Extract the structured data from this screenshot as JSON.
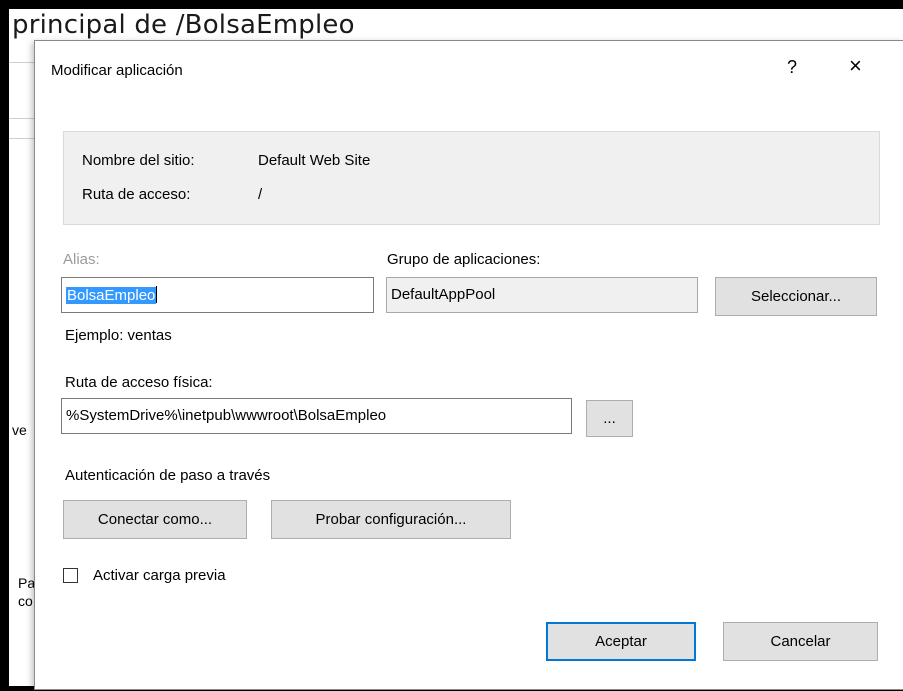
{
  "background": {
    "title": "principal de /BolsaEmpleo",
    "fragments": [
      "ve",
      "Pa",
      "co"
    ]
  },
  "dialog": {
    "title": "Modificar aplicación",
    "help_label": "?",
    "close_label": "×",
    "site_name_label": "Nombre del sitio:",
    "site_name_value": "Default Web Site",
    "path_label": "Ruta de acceso:",
    "path_value": "/",
    "alias_label": "Alias:",
    "alias_value": "BolsaEmpleo",
    "alias_example": "Ejemplo: ventas",
    "app_pool_label": "Grupo de aplicaciones:",
    "app_pool_value": "DefaultAppPool",
    "select_button": "Seleccionar...",
    "physical_path_label": "Ruta de acceso física:",
    "physical_path_value": "%SystemDrive%\\inetpub\\wwwroot\\BolsaEmpleo",
    "browse_button": "...",
    "passthrough_label": "Autenticación de paso a través",
    "connect_as_button": "Conectar como...",
    "test_settings_button": "Probar configuración...",
    "preload_label": "Activar carga previa",
    "preload_checked": false,
    "ok_button": "Aceptar",
    "cancel_button": "Cancelar"
  },
  "colors": {
    "accent": "#0078d7",
    "selection": "#3399ff"
  }
}
